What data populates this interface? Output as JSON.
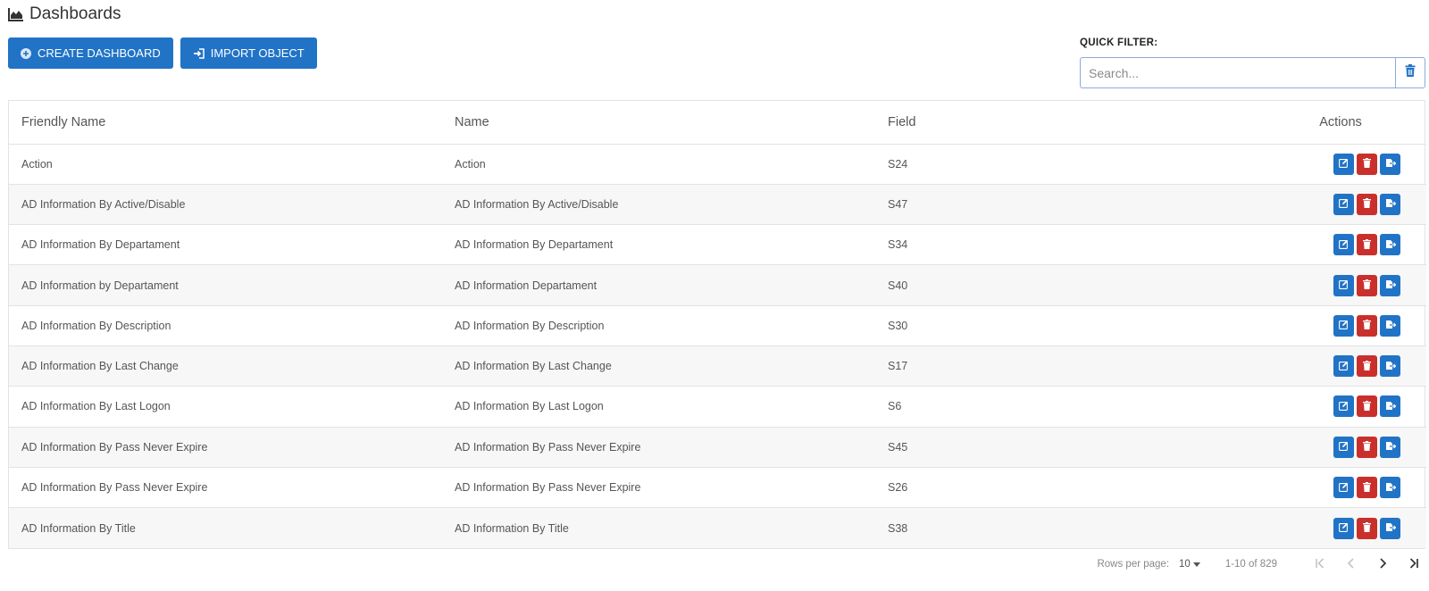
{
  "page": {
    "title": "Dashboards",
    "title_icon": "area-chart-icon"
  },
  "toolbar": {
    "create_label": "CREATE DASHBOARD",
    "create_icon": "plus-circle-icon",
    "import_label": "IMPORT OBJECT",
    "import_icon": "sign-in-icon"
  },
  "quick_filter": {
    "label": "QUICK FILTER:",
    "placeholder": "Search...",
    "value": "",
    "clear_icon": "trash-icon"
  },
  "table": {
    "headers": {
      "friendly_name": "Friendly Name",
      "name": "Name",
      "field": "Field",
      "actions": "Actions"
    },
    "rows": [
      {
        "friendly_name": "Action",
        "name": "Action",
        "field": "S24"
      },
      {
        "friendly_name": "AD Information By Active/Disable",
        "name": "AD Information By Active/Disable",
        "field": "S47"
      },
      {
        "friendly_name": "AD Information By Departament",
        "name": "AD Information By Departament",
        "field": "S34"
      },
      {
        "friendly_name": "AD Information by Departament",
        "name": "AD Information Departament",
        "field": "S40"
      },
      {
        "friendly_name": "AD Information By Description",
        "name": "AD Information By Description",
        "field": "S30"
      },
      {
        "friendly_name": "AD Information By Last Change",
        "name": "AD Information By Last Change",
        "field": "S17"
      },
      {
        "friendly_name": "AD Information By Last Logon",
        "name": "AD Information By Last Logon",
        "field": "S6"
      },
      {
        "friendly_name": "AD Information By Pass Never Expire",
        "name": "AD Information By Pass Never Expire",
        "field": "S45"
      },
      {
        "friendly_name": "AD Information By Pass Never Expire",
        "name": "AD Information By Pass Never Expire",
        "field": "S26"
      },
      {
        "friendly_name": "AD Information By Title",
        "name": "AD Information By Title",
        "field": "S38"
      }
    ],
    "row_action_icons": [
      "edit-icon",
      "trash-icon",
      "export-icon"
    ]
  },
  "pagination": {
    "rows_per_page_label": "Rows per page:",
    "rows_per_page": "10",
    "range": "1-10 of 829",
    "icons": [
      "first-page-icon",
      "previous-page-icon",
      "next-page-icon",
      "last-page-icon"
    ]
  },
  "colors": {
    "primary": "#2173c6",
    "danger": "#c9302c",
    "border": "#e3e3e3",
    "stripe": "#f7f7f7"
  }
}
